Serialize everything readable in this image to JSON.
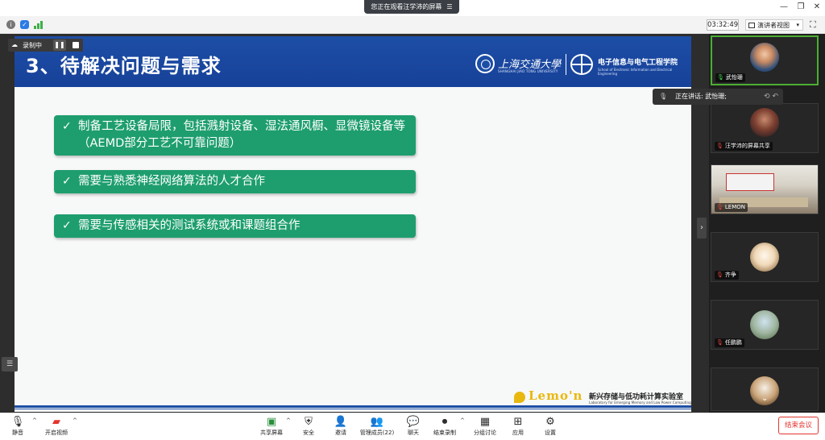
{
  "window": {
    "share_banner": "您正在观看汪学沛的屏幕",
    "banner_menu": "☰",
    "minimize": "—",
    "restore": "❐",
    "close": "✕"
  },
  "topbar": {
    "timer": "03:32:49",
    "view_mode": "演讲者视图",
    "view_caret": "▾",
    "fullscreen": "⛶",
    "info_icon": "i",
    "shield_icon": "✓"
  },
  "recording": {
    "label": "录制中",
    "pause": "❚❚"
  },
  "slide": {
    "title": "3、待解决问题与需求",
    "sjtu_name": "上海交通大學",
    "sjtu_sub": "SHANGHAI JIAO TONG UNIVERSITY",
    "seiee_name": "电子信息与电气工程学院",
    "seiee_sub": "School of Electronic Information and Electrical Engineering",
    "bullets": [
      "制备工艺设备局限，包括溅射设备、湿法通风橱、显微镜设备等（AEMD部分工艺不可靠问题）",
      "需要与熟悉神经网络算法的人才合作",
      "需要与传感相关的测试系统或和课题组合作"
    ],
    "check": "✓",
    "lab_logo": "Lemo'n",
    "lab_name": "新兴存储与低功耗计算实验室",
    "lab_sub": "Laboratory for Emerging Memory and Low Power Computing"
  },
  "speaking": {
    "text": "正在讲话: 武怡珊;",
    "mic": "🎙"
  },
  "gallery": {
    "arrow": "›",
    "participants": [
      {
        "name": "武怡珊",
        "muted": false
      },
      {
        "name": "汪学沛的屏幕共享",
        "muted": true
      },
      {
        "name": "LEMON",
        "muted": true
      },
      {
        "name": "齐争",
        "muted": true
      },
      {
        "name": "任鹏鹏",
        "muted": true
      },
      {
        "name": "",
        "muted": true
      }
    ],
    "mic_on": "🎙",
    "mic_off": "🎙",
    "more": "⌄"
  },
  "toolbar": {
    "mute": "静音",
    "start_video": "开启视频",
    "share_screen": "共享屏幕",
    "security": "安全",
    "invite": "邀请",
    "participants": "管理成员(22)",
    "chat": "聊天",
    "stop_recording": "结束录制",
    "breakout": "分组讨论",
    "apps": "应用",
    "settings": "设置",
    "end_meeting": "结束会议",
    "caret": "^"
  },
  "side_handle": "☰",
  "colors": {
    "slide_header": "#1d4ea6",
    "bullet_green": "#1e9e6e",
    "end_red": "#e3342f",
    "active_border": "#4cae32"
  }
}
